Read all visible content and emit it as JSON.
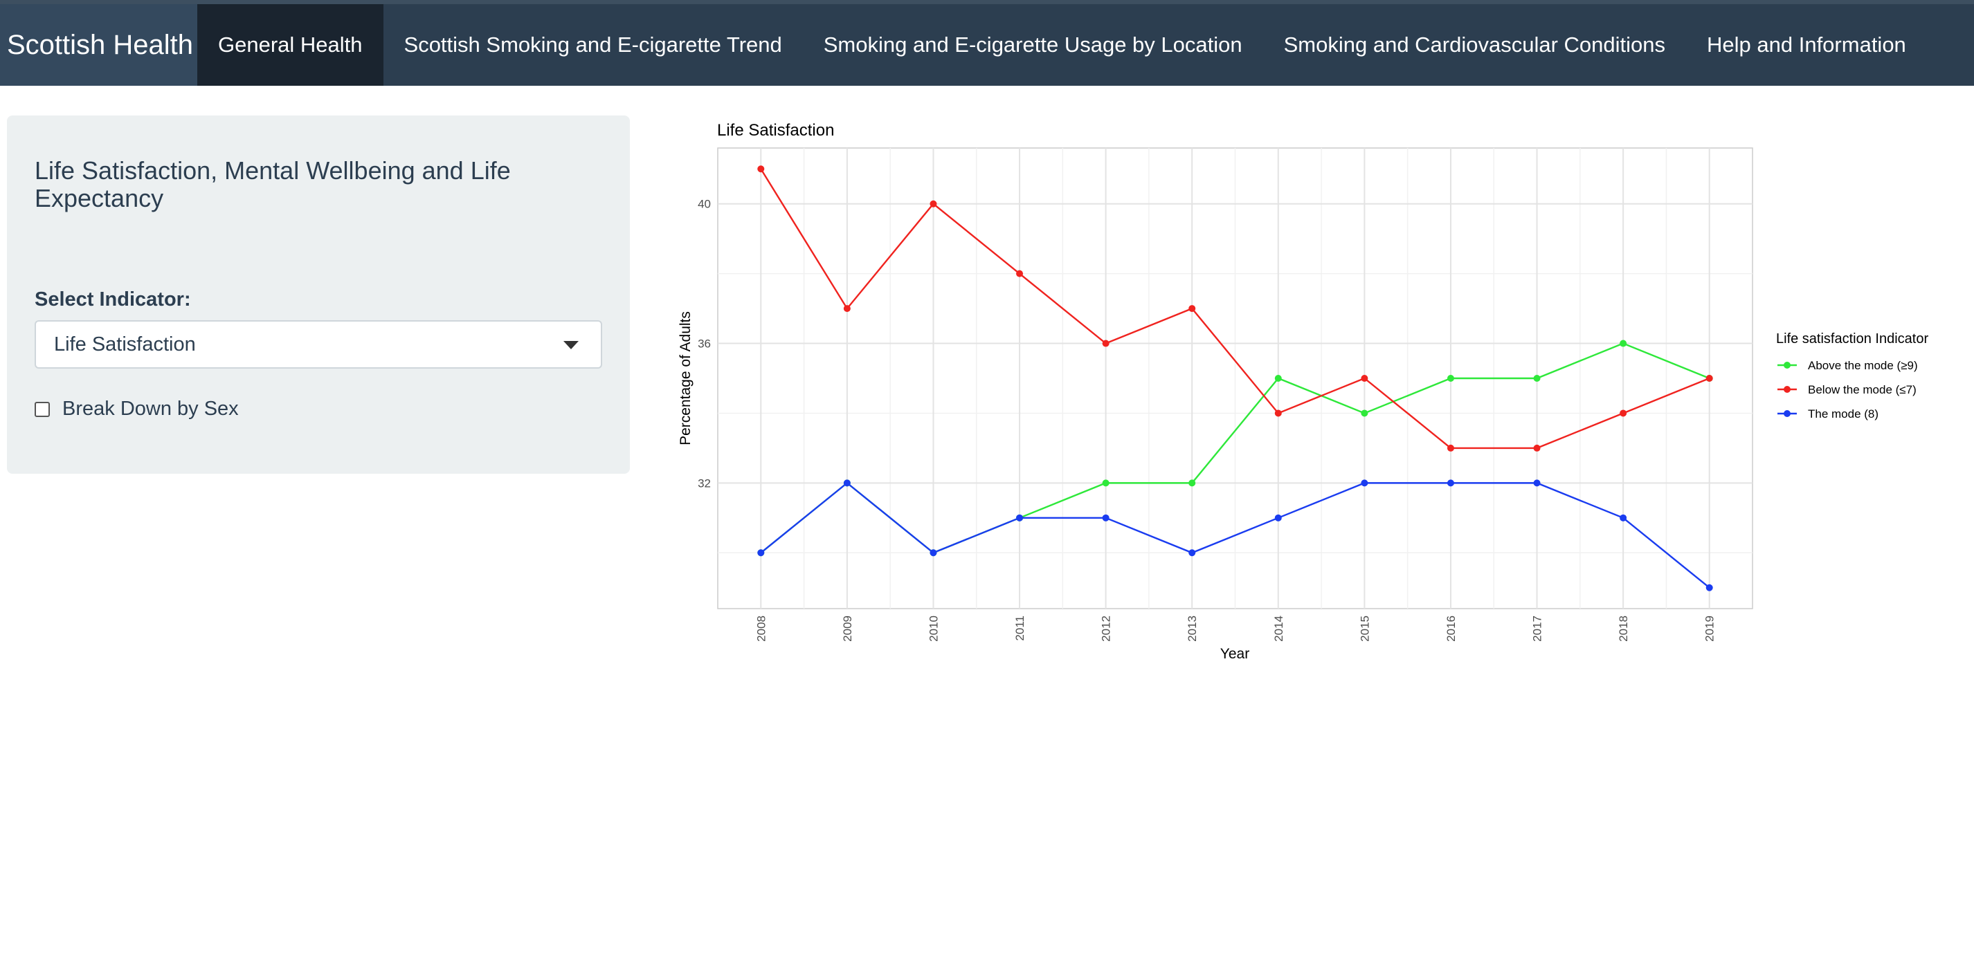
{
  "navbar": {
    "brand": "Scottish Health",
    "tabs": [
      {
        "label": "General Health",
        "active": true
      },
      {
        "label": "Scottish Smoking and E-cigarette Trend",
        "active": false
      },
      {
        "label": "Smoking and E-cigarette Usage by Location",
        "active": false
      },
      {
        "label": "Smoking and Cardiovascular Conditions",
        "active": false
      },
      {
        "label": "Help and Information",
        "active": false
      }
    ]
  },
  "sidebar": {
    "title": "Life Satisfaction, Mental Wellbeing and Life Expectancy",
    "select_label": "Select Indicator:",
    "select_value": "Life Satisfaction",
    "checkbox_label": "Break Down by Sex",
    "checkbox_checked": false
  },
  "chart_data": {
    "type": "line",
    "title": "Life Satisfaction",
    "xlabel": "Year",
    "ylabel": "Percentage of Adults",
    "x": [
      "2008",
      "2009",
      "2010",
      "2011",
      "2012",
      "2013",
      "2014",
      "2015",
      "2016",
      "2017",
      "2018",
      "2019"
    ],
    "ylim": [
      28.4,
      41.6
    ],
    "yticks": [
      32,
      36,
      40
    ],
    "grid": true,
    "legend_title": "Life satisfaction Indicator",
    "legend_position": "right",
    "series": [
      {
        "name": "Above the mode (≥9)",
        "color": "#2ee83a",
        "values": [
          30,
          32,
          30,
          31,
          32,
          32,
          35,
          34,
          35,
          35,
          36,
          35
        ]
      },
      {
        "name": "Below the mode (≤7)",
        "color": "#f0231f",
        "values": [
          41,
          37,
          40,
          38,
          36,
          37,
          34,
          35,
          33,
          33,
          34,
          35
        ]
      },
      {
        "name": "The mode (8)",
        "color": "#1a3cf0",
        "values": [
          30,
          32,
          30,
          31,
          31,
          30,
          31,
          32,
          32,
          32,
          31,
          29
        ]
      }
    ]
  }
}
